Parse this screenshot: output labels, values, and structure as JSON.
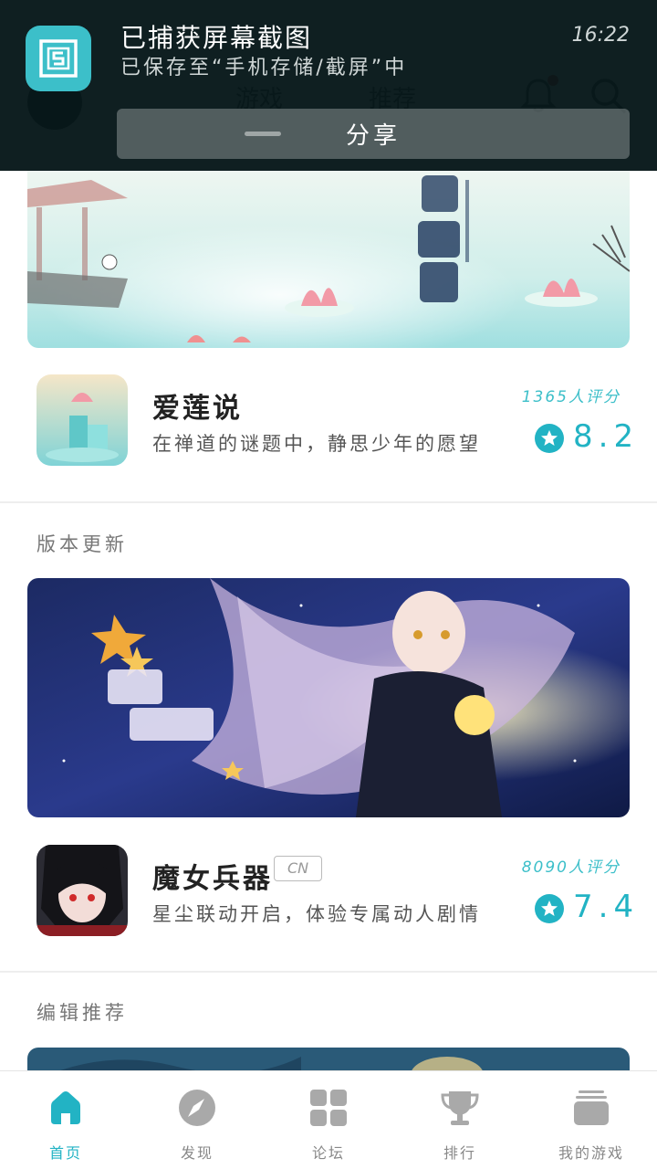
{
  "notification": {
    "title": "已捕获屏幕截图",
    "subtitle": "已保存至“手机存储/截屏”中",
    "time": "16:22",
    "share_label": "分享",
    "icon": "screenshot-icon"
  },
  "header": {
    "tabs": [
      "游戏",
      "推荐"
    ],
    "icons": [
      "bell-icon",
      "search-icon"
    ]
  },
  "games": [
    {
      "name": "爱莲说",
      "description": "在禅道的谜题中，静思少年的愿望",
      "rating_count": "1365人评分",
      "score": "8.2",
      "tag": ""
    },
    {
      "name": "魔女兵器",
      "description": "星尘联动开启，体验专属动人剧情",
      "rating_count": "8090人评分",
      "score": "7.4",
      "tag": "CN"
    }
  ],
  "sections": {
    "version_update": "版本更新",
    "editor_pick": "编辑推荐"
  },
  "bottom_nav": [
    {
      "label": "首页",
      "icon": "home-icon",
      "active": true
    },
    {
      "label": "发现",
      "icon": "compass-icon",
      "active": false
    },
    {
      "label": "论坛",
      "icon": "grid-icon",
      "active": false
    },
    {
      "label": "排行",
      "icon": "trophy-icon",
      "active": false
    },
    {
      "label": "我的游戏",
      "icon": "stack-icon",
      "active": false
    }
  ],
  "colors": {
    "accent": "#22b3c4",
    "notification_bg": "#051618"
  }
}
